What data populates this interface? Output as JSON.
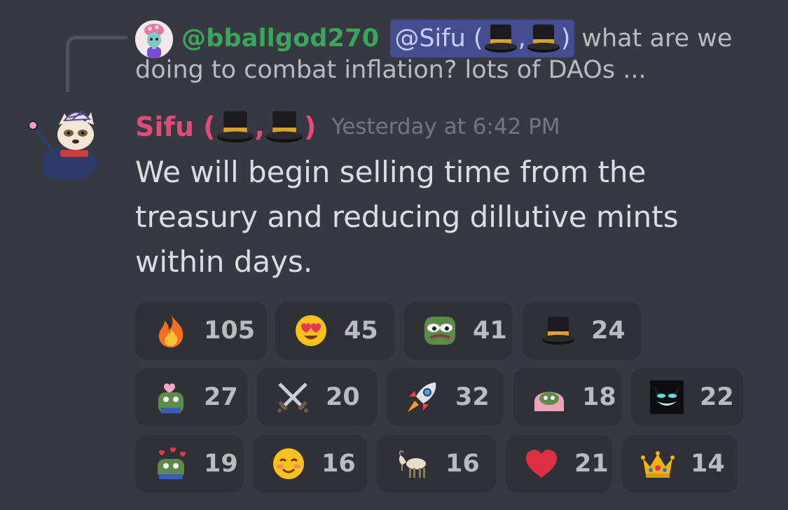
{
  "reply": {
    "author": "@bballgod270",
    "mention_prefix": "@Sifu (",
    "mention_comma": ",",
    "mention_suffix": ")",
    "snippet_line1": "what are we",
    "snippet_line2": "doing to combat inflation? lots of DAOs ..."
  },
  "message": {
    "author_prefix": "Sifu (",
    "author_comma": ",",
    "author_suffix": ")",
    "timestamp": "Yesterday at 6:42 PM",
    "body": "We will begin selling time from the treasury and reducing dillutive mints within days.",
    "author_color": "#e24a7a"
  },
  "reactions": [
    {
      "emoji": "fire-emoji",
      "count": "105"
    },
    {
      "emoji": "heart-eyes-emoji",
      "count": "45"
    },
    {
      "emoji": "pepe-emoji",
      "count": "41"
    },
    {
      "emoji": "top-hat-emoji",
      "count": "24"
    },
    {
      "emoji": "pepe-love-emoji",
      "count": "27"
    },
    {
      "emoji": "crossed-swords-emoji",
      "count": "20"
    },
    {
      "emoji": "rocket-emoji",
      "count": "32"
    },
    {
      "emoji": "pepe-blanket-emoji",
      "count": "18"
    },
    {
      "emoji": "cat-grin-emoji",
      "count": "22"
    },
    {
      "emoji": "pepe-hearts-emoji",
      "count": "19"
    },
    {
      "emoji": "smiling-blush-emoji",
      "count": "16"
    },
    {
      "emoji": "goat-emoji",
      "count": "16"
    },
    {
      "emoji": "red-heart-emoji",
      "count": "21"
    },
    {
      "emoji": "crown-emoji",
      "count": "14"
    }
  ],
  "colors": {
    "background": "#36393f",
    "reaction_bg": "#2f3136",
    "reply_author": "#3ba55c",
    "mention_bg": "#5865f2"
  }
}
